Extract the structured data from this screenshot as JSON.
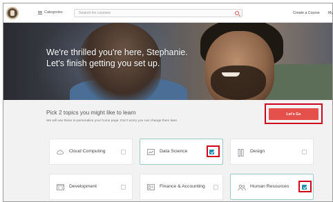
{
  "header": {
    "categories_label": "Categories",
    "search_placeholder": "Search for courses",
    "create_course_label": "Create a Course",
    "my_label": "My",
    "logo_icon": "university-seal-icon",
    "search_icon": "search-icon",
    "accent_color": "#d9534f"
  },
  "hero": {
    "line1": "We're thrilled you're here, Stephanie.",
    "line2": "Let's finish getting you set up."
  },
  "topics": {
    "heading": "Pick 2 topics you might like to learn",
    "subtext": "We will use these to personalize your home page. Don't worry you can change them later.",
    "cta_label": "Let's Go",
    "cta_color": "#e5504b",
    "highlight_color": "#d0021b",
    "items": [
      {
        "label": "Cloud Computing",
        "icon": "cloud-icon",
        "checked": false
      },
      {
        "label": "Data Science",
        "icon": "chart-icon",
        "checked": true
      },
      {
        "label": "Design",
        "icon": "design-icon",
        "checked": false
      },
      {
        "label": "Development",
        "icon": "code-window-icon",
        "checked": false
      },
      {
        "label": "Finance & Accounting",
        "icon": "finance-icon",
        "checked": false
      },
      {
        "label": "Human Resources",
        "icon": "people-icon",
        "checked": true
      }
    ]
  }
}
